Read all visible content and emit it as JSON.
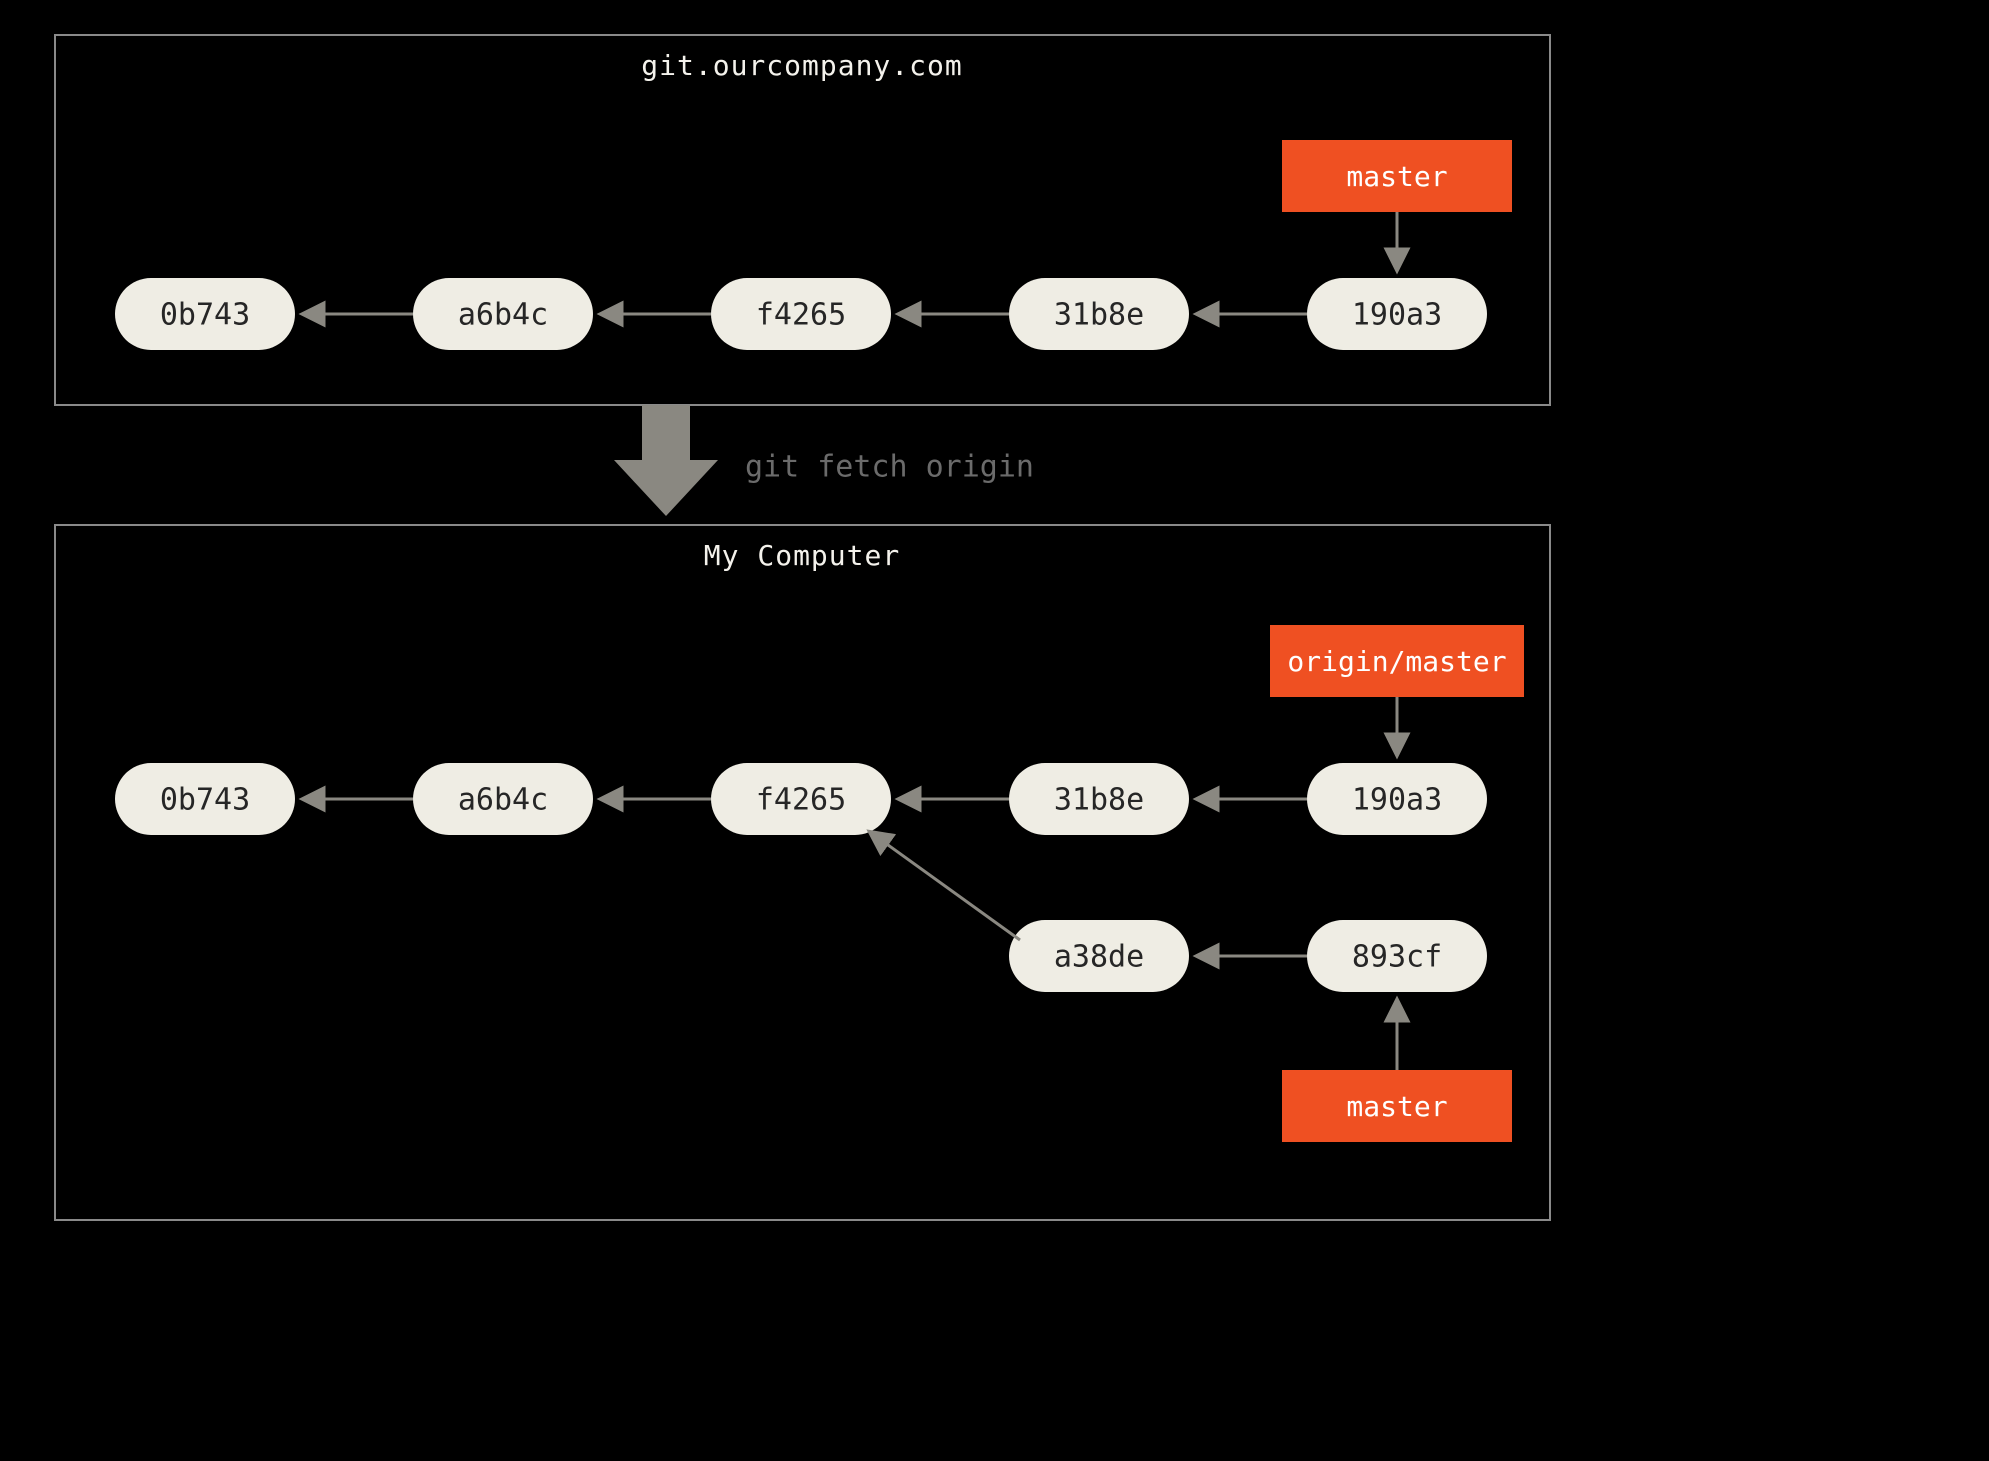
{
  "remote": {
    "title": "git.ourcompany.com",
    "commits": [
      "0b743",
      "a6b4c",
      "f4265",
      "31b8e",
      "190a3"
    ],
    "branch_master": "master"
  },
  "fetch_command": "git fetch origin",
  "local": {
    "title": "My Computer",
    "commits_top": [
      "0b743",
      "a6b4c",
      "f4265",
      "31b8e",
      "190a3"
    ],
    "commits_bottom": [
      "a38de",
      "893cf"
    ],
    "branch_origin_master": "origin/master",
    "branch_master": "master"
  },
  "colors": {
    "background": "#000000",
    "commit_fill": "#efede4",
    "commit_text": "#262626",
    "branch_fill": "#ef5022",
    "branch_text": "#ffffff",
    "border": "#8a8a8a",
    "arrow": "#8a8881",
    "title": "#f4f2ec",
    "muted": "#6b6b6b"
  }
}
